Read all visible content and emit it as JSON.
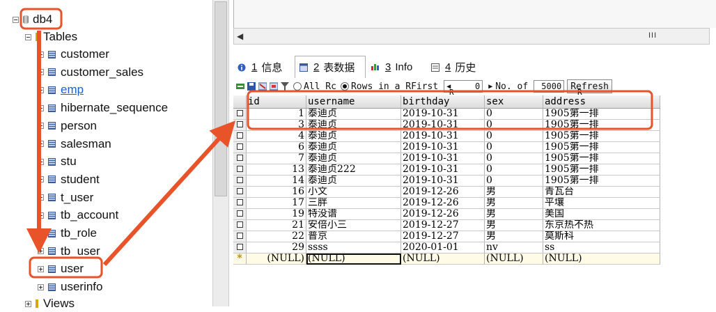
{
  "tree": {
    "db": "db4",
    "tables_folder": "Tables",
    "tables": [
      "customer",
      "customer_sales",
      "emp",
      "hibernate_sequence",
      "person",
      "salesman",
      "stu",
      "student",
      "t_user",
      "tb_account",
      "tb_role",
      "tb_user",
      "user",
      "userinfo"
    ],
    "views_folder": "Views"
  },
  "tabs": [
    {
      "num": "1",
      "label": "信息",
      "icon": "info-icon"
    },
    {
      "num": "2",
      "label": "表数据",
      "icon": "table-data-icon"
    },
    {
      "num": "3",
      "label": "Info",
      "icon": "info-color-icon"
    },
    {
      "num": "4",
      "label": "历史",
      "icon": "history-icon"
    }
  ],
  "toolbar": {
    "all_rows": "All Rc",
    "rows_in_range": "Rows in a R",
    "first_label": "First",
    "first_value": "0",
    "no_of_label": "No. of",
    "no_of_value": "5000",
    "refresh": "Refresh",
    "first_sub": "R",
    "no_of_sub": "R"
  },
  "grid": {
    "columns": [
      "id",
      "username",
      "birthday",
      "sex",
      "address"
    ],
    "rows": [
      [
        "1",
        "泰迪贞",
        "2019-10-31",
        "0",
        "1905第一排"
      ],
      [
        "3",
        "泰迪贞",
        "2019-10-31",
        "0",
        "1905第一排"
      ],
      [
        "4",
        "泰迪贞",
        "2019-10-31",
        "0",
        "1905第一排"
      ],
      [
        "6",
        "泰迪贞",
        "2019-10-31",
        "0",
        "1905第一排"
      ],
      [
        "7",
        "泰迪贞",
        "2019-10-31",
        "0",
        "1905第一排"
      ],
      [
        "13",
        "泰迪贞222",
        "2019-10-31",
        "0",
        "1905第一排"
      ],
      [
        "14",
        "泰迪贞",
        "2019-10-31",
        "0",
        "1905第一排"
      ],
      [
        "16",
        "小文",
        "2019-12-26",
        "男",
        "青瓦台"
      ],
      [
        "17",
        "三胖",
        "2019-12-26",
        "男",
        "平壤"
      ],
      [
        "19",
        "特没谱",
        "2019-12-26",
        "男",
        "美国"
      ],
      [
        "21",
        "安倍小三",
        "2019-12-27",
        "男",
        "东京热不热"
      ],
      [
        "22",
        "普京",
        "2019-12-27",
        "男",
        "莫斯科"
      ],
      [
        "29",
        "ssss",
        "2020-01-01",
        "nv",
        "ss"
      ]
    ],
    "new_row": [
      "(NULL)",
      "(NULL)",
      "(NULL)",
      "(NULL)",
      "(NULL)"
    ],
    "new_row_marker": "*"
  },
  "scroll": {
    "grip": "III"
  },
  "colors": {
    "annotation": "#e8532a",
    "link": "#1a5fd0"
  }
}
